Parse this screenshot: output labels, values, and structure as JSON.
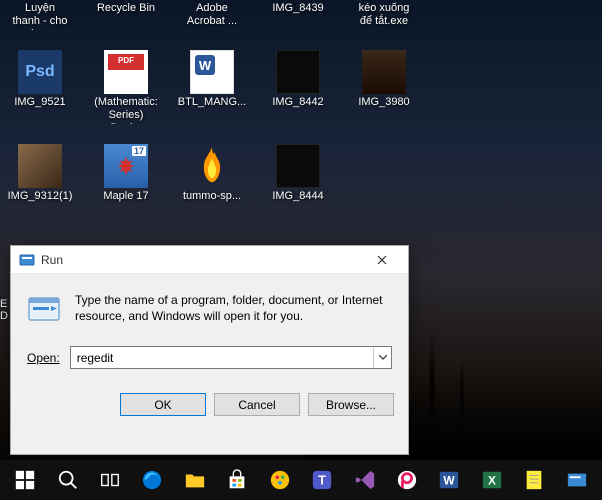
{
  "desktop": {
    "rows": [
      [
        {
          "label": "Luyện thanh - cho gion...",
          "kind": "blank"
        },
        {
          "label": "Recycle Bin",
          "kind": "blank"
        },
        {
          "label": "Adobe Acrobat ...",
          "kind": "blank"
        },
        {
          "label": "IMG_8439",
          "kind": "blank"
        },
        {
          "label": "kéo xuống để tắt.exe",
          "kind": "blank"
        }
      ],
      [
        {
          "label": "IMG_9521",
          "kind": "psd",
          "badge": "Psd"
        },
        {
          "label": "(Mathematic: Series) Davi...",
          "kind": "pdf"
        },
        {
          "label": "BTL_MANG...",
          "kind": "docx"
        },
        {
          "label": "IMG_8442",
          "kind": "dark"
        },
        {
          "label": "IMG_3980",
          "kind": "brown"
        }
      ],
      [
        {
          "label": "IMG_9312(1)",
          "kind": "photo"
        },
        {
          "label": "Maple 17",
          "kind": "maple",
          "badge": "17"
        },
        {
          "label": "tummo-sp...",
          "kind": "fire"
        },
        {
          "label": "IMG_8444",
          "kind": "dark"
        }
      ]
    ]
  },
  "run": {
    "title": "Run",
    "description": "Type the name of a program, folder, document, or Internet resource, and Windows will open it for you.",
    "open_label": "Open:",
    "input_value": "regedit",
    "ok": "OK",
    "cancel": "Cancel",
    "browse": "Browse..."
  },
  "taskbar": {
    "items": [
      "start",
      "search",
      "task-view",
      "edge",
      "folder",
      "store",
      "paint",
      "teams",
      "visual-studio",
      "picsart",
      "word",
      "excel",
      "notes",
      "run"
    ]
  }
}
